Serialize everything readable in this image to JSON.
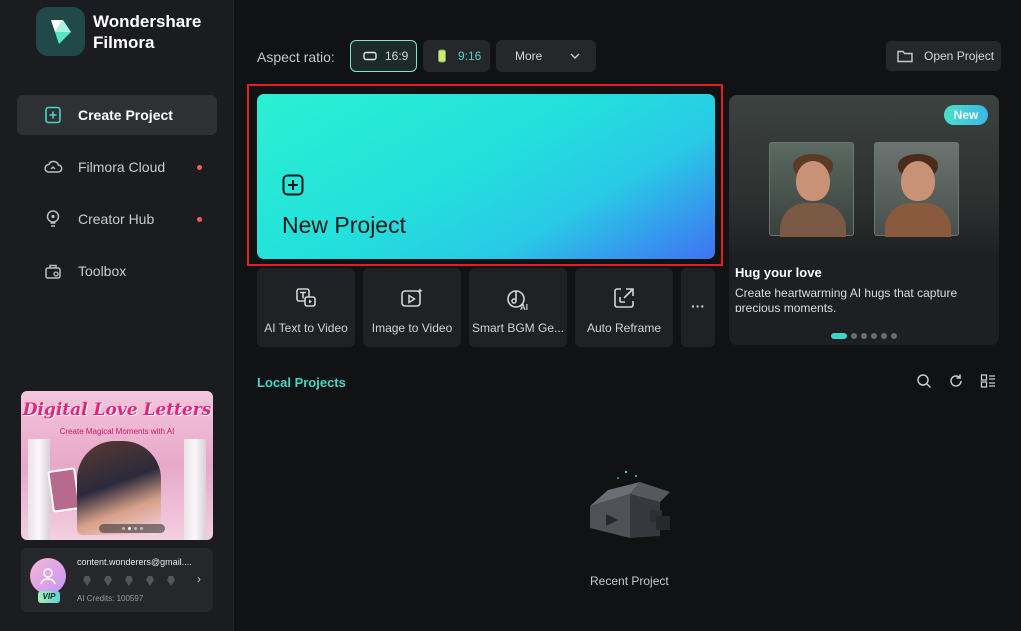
{
  "app": {
    "name_line1": "Wondershare",
    "name_line2": "Filmora"
  },
  "sidebar": {
    "items": [
      {
        "label": "Create Project",
        "icon": "plus-square-icon",
        "active": true,
        "dot": false
      },
      {
        "label": "Filmora Cloud",
        "icon": "cloud-icon",
        "active": false,
        "dot": true
      },
      {
        "label": "Creator Hub",
        "icon": "bulb-icon",
        "active": false,
        "dot": true
      },
      {
        "label": "Toolbox",
        "icon": "toolbox-icon",
        "active": false,
        "dot": false
      }
    ],
    "promo": {
      "title": "Digital Love Letters",
      "subtitle": "Create Magical Moments with AI"
    },
    "account": {
      "email": "content.wonderers@gmail....",
      "vip": "VIP",
      "credits": "AI Credits: 100597"
    }
  },
  "toolbar": {
    "aspect_label": "Aspect ratio:",
    "ratio_169": "16:9",
    "ratio_916": "9:16",
    "more": "More",
    "open_project": "Open Project"
  },
  "new_project": {
    "label": "New Project"
  },
  "tools": [
    {
      "label": "AI Text to Video",
      "icon": "ai-text-video-icon"
    },
    {
      "label": "Image to Video",
      "icon": "image-video-icon"
    },
    {
      "label": "Smart BGM Ge...",
      "icon": "ai-music-icon"
    },
    {
      "label": "Auto Reframe",
      "icon": "reframe-icon"
    }
  ],
  "more_tools": "···",
  "feature": {
    "badge": "New",
    "title": "Hug your love",
    "description": "Create heartwarming AI hugs that capture precious moments."
  },
  "local": {
    "title": "Local Projects",
    "empty_label": "Recent Project"
  },
  "colors": {
    "accent": "#45d6c5",
    "highlight": "#e41e25",
    "notify": "#ff5a5f"
  }
}
